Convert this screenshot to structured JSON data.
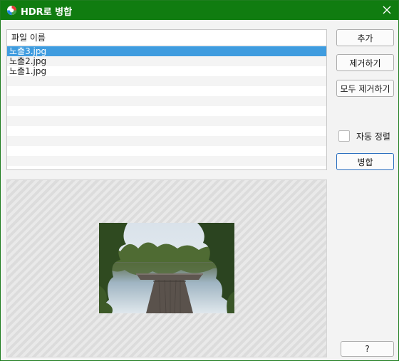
{
  "window": {
    "title": "HDR로 병합",
    "accent_color": "#107c10",
    "icons": {
      "app": "hdr-app-icon",
      "close": "close-icon"
    }
  },
  "file_list": {
    "header": "파일 이름",
    "items": [
      "노출3.jpg",
      "노출2.jpg",
      "노출1.jpg"
    ],
    "selected_index": 0,
    "selection_color": "#3f9cdf"
  },
  "buttons": {
    "add": "추가",
    "remove": "제거하기",
    "remove_all": "모두 제거하기",
    "merge": "병합",
    "help": "?"
  },
  "options": {
    "auto_align_label": "자동 정렬",
    "auto_align_checked": false
  },
  "preview": {
    "image_subject": "lake-dock-photo"
  }
}
